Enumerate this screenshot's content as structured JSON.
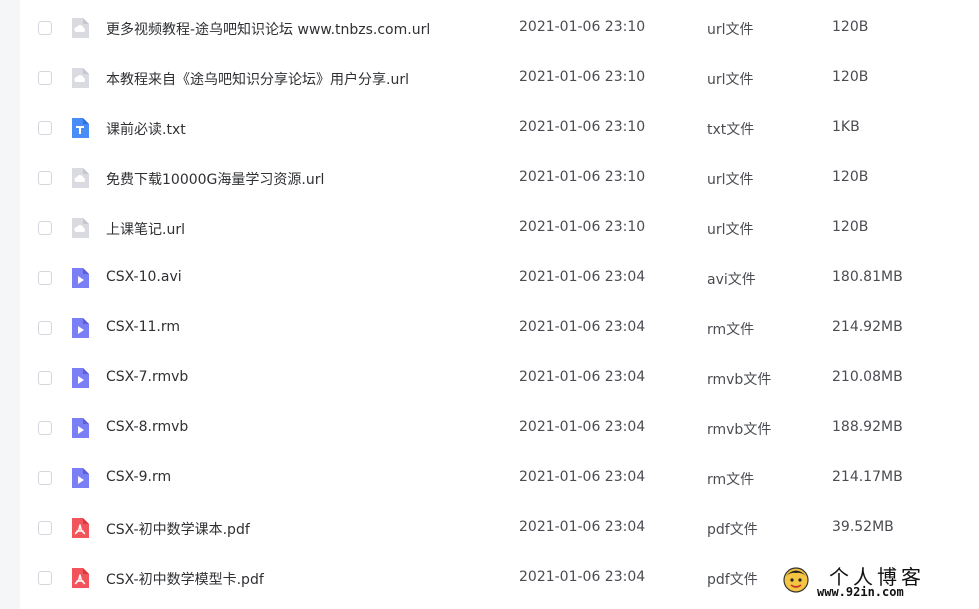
{
  "files": [
    {
      "name": "更多视频教程-途乌吧知识论坛 www.tnbzs.com.url",
      "date": "2021-01-06 23:10",
      "type": "url文件",
      "size": "120B",
      "icon": "link-file-icon"
    },
    {
      "name": "本教程来自《途乌吧知识分享论坛》用户分享.url",
      "date": "2021-01-06 23:10",
      "type": "url文件",
      "size": "120B",
      "icon": "link-file-icon"
    },
    {
      "name": "课前必读.txt",
      "date": "2021-01-06 23:10",
      "type": "txt文件",
      "size": "1KB",
      "icon": "text-file-icon"
    },
    {
      "name": "免费下载10000G海量学习资源.url",
      "date": "2021-01-06 23:10",
      "type": "url文件",
      "size": "120B",
      "icon": "link-file-icon"
    },
    {
      "name": "上课笔记.url",
      "date": "2021-01-06 23:10",
      "type": "url文件",
      "size": "120B",
      "icon": "link-file-icon"
    },
    {
      "name": "CSX-10.avi",
      "date": "2021-01-06 23:04",
      "type": "avi文件",
      "size": "180.81MB",
      "icon": "video-file-icon"
    },
    {
      "name": "CSX-11.rm",
      "date": "2021-01-06 23:04",
      "type": "rm文件",
      "size": "214.92MB",
      "icon": "video-file-icon"
    },
    {
      "name": "CSX-7.rmvb",
      "date": "2021-01-06 23:04",
      "type": "rmvb文件",
      "size": "210.08MB",
      "icon": "video-file-icon"
    },
    {
      "name": "CSX-8.rmvb",
      "date": "2021-01-06 23:04",
      "type": "rmvb文件",
      "size": "188.92MB",
      "icon": "video-file-icon"
    },
    {
      "name": "CSX-9.rm",
      "date": "2021-01-06 23:04",
      "type": "rm文件",
      "size": "214.17MB",
      "icon": "video-file-icon"
    },
    {
      "name": "CSX-初中数学课本.pdf",
      "date": "2021-01-06 23:04",
      "type": "pdf文件",
      "size": "39.52MB",
      "icon": "pdf-file-icon"
    },
    {
      "name": "CSX-初中数学模型卡.pdf",
      "date": "2021-01-06 23:04",
      "type": "pdf文件",
      "size": "",
      "icon": "pdf-file-icon"
    }
  ],
  "colors": {
    "link_icon": "#d9dbe0",
    "text_icon": "#4a8cf7",
    "video_icon": "#7b7ff5",
    "pdf_icon": "#f2545b"
  },
  "watermark": {
    "title": "个人博客",
    "url": "www.92in.com"
  }
}
